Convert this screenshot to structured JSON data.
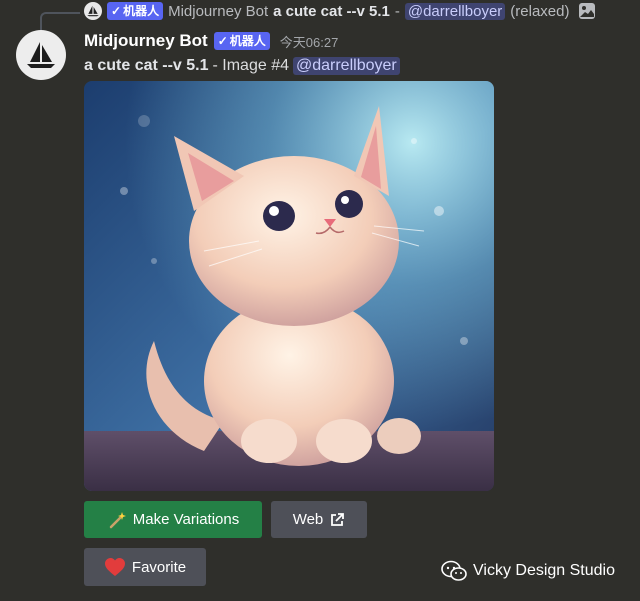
{
  "reply": {
    "bot_name": "Midjourney Bot",
    "badge": "机器人",
    "prompt": "a cute cat --v 5.1",
    "separator": " - ",
    "mention": "@darrellboyer",
    "mode": "(relaxed)",
    "icon": "image-icon"
  },
  "message": {
    "username": "Midjourney Bot",
    "badge": "机器人",
    "badge_check": "✓",
    "timestamp": "今天06:27",
    "prompt": "a cute cat --v 5.1",
    "image_label": "- Image #4",
    "mention": "@darrellboyer"
  },
  "image": {
    "subject": "cat",
    "icon": "kitten-illustration"
  },
  "buttons": {
    "make_variations": "Make Variations",
    "make_variations_icon": "magic-wand-icon",
    "web": "Web",
    "web_icon": "external-link-icon",
    "favorite": "Favorite",
    "favorite_icon": "heart-icon"
  },
  "watermark": {
    "text": "Vicky Design Studio",
    "icon": "wechat-icon"
  },
  "colors": {
    "background": "#2f2f2b",
    "badge": "#5865f2",
    "green_button": "#248046",
    "grey_button": "#4e5058",
    "mention_bg": "#3f4470",
    "heart": "#e23c3c"
  }
}
